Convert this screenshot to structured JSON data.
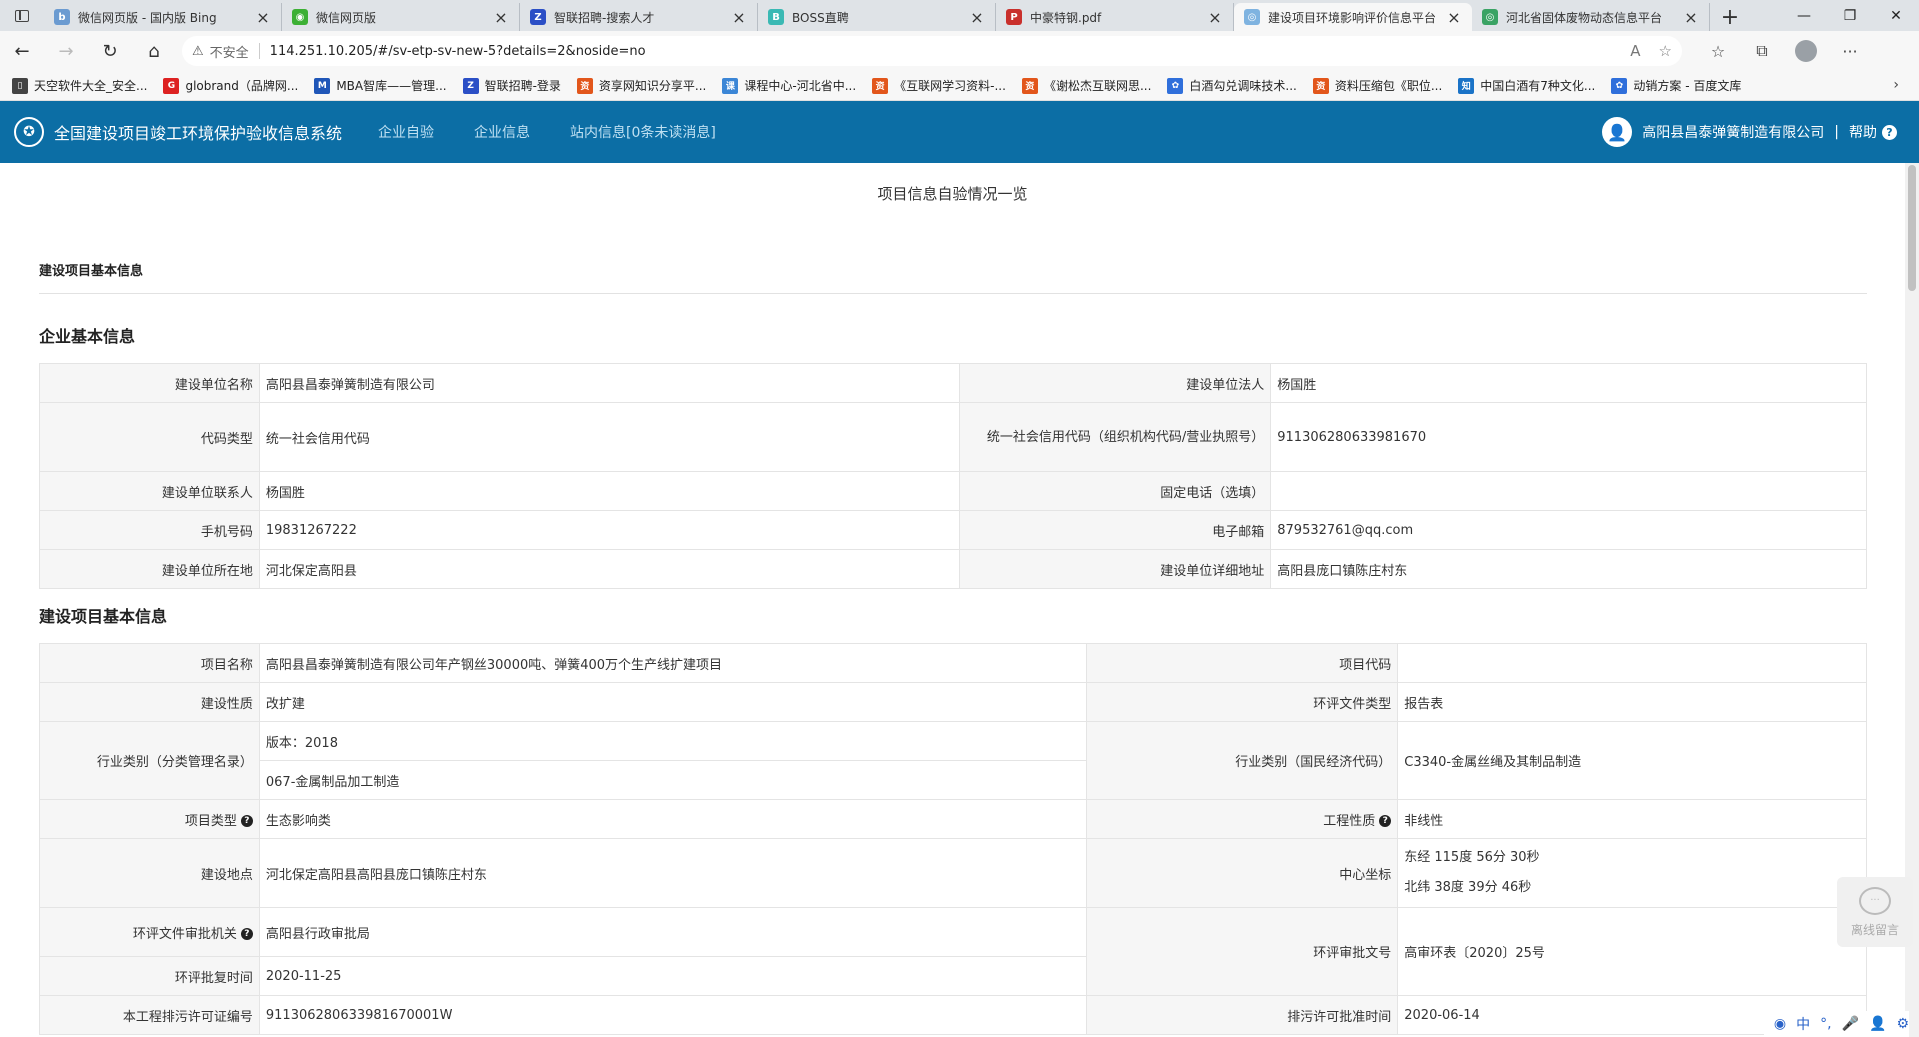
{
  "browser": {
    "tabs": [
      {
        "title": "微信网页版 - 国内版 Bing",
        "fav_color": "#6b9bd1",
        "fav_glyph": "b",
        "active": false
      },
      {
        "title": "微信网页版",
        "fav_color": "#3cb034",
        "fav_glyph": "◉",
        "active": false
      },
      {
        "title": "智联招聘-搜索人才",
        "fav_color": "#2b4fc6",
        "fav_glyph": "Z",
        "active": false
      },
      {
        "title": "BOSS直聘",
        "fav_color": "#3ab9b4",
        "fav_glyph": "B",
        "active": false
      },
      {
        "title": "中豪特钢.pdf",
        "fav_color": "#c9302c",
        "fav_glyph": "P",
        "active": false
      },
      {
        "title": "建设项目环境影响评价信息平台",
        "fav_color": "#7fb3e0",
        "fav_glyph": "◎",
        "active": true
      },
      {
        "title": "河北省固体废物动态信息平台",
        "fav_color": "#3aa364",
        "fav_glyph": "◎",
        "active": false
      }
    ],
    "address": {
      "security_label": "不安全",
      "url": "114.251.10.205/#/sv-etp-sv-new-5?details=2&noside=no"
    },
    "bookmarks": [
      {
        "label": "天空软件大全_安全...",
        "color": "#444",
        "glyph": "▯"
      },
      {
        "label": "globrand（品牌网...",
        "color": "#d22",
        "glyph": "G"
      },
      {
        "label": "MBA智库——管理...",
        "color": "#1f56b8",
        "glyph": "M"
      },
      {
        "label": "智联招聘-登录",
        "color": "#2b4fc6",
        "glyph": "Z"
      },
      {
        "label": "资享网知识分享平...",
        "color": "#e2561b",
        "glyph": "资"
      },
      {
        "label": "课程中心-河北省中...",
        "color": "#3b86d6",
        "glyph": "课"
      },
      {
        "label": "《互联网学习资料-...",
        "color": "#e2561b",
        "glyph": "资"
      },
      {
        "label": "《谢松杰互联网思...",
        "color": "#e2561b",
        "glyph": "资"
      },
      {
        "label": "白酒勾兑调味技术...",
        "color": "#2f6fdb",
        "glyph": "✿"
      },
      {
        "label": "资料压缩包《职位...",
        "color": "#e2561b",
        "glyph": "资"
      },
      {
        "label": "中国白酒有7种文化...",
        "color": "#1a73c7",
        "glyph": "知"
      },
      {
        "label": "动销方案 - 百度文库",
        "color": "#2f6fdb",
        "glyph": "✿"
      }
    ]
  },
  "app": {
    "system_title": "全国建设项目竣工环境保护验收信息系统",
    "nav": [
      "企业自验",
      "企业信息",
      "站内信息[0条未读消息]"
    ],
    "user_name": "高阳县昌泰弹簧制造有限公司",
    "help_label": "帮助",
    "separator": "|"
  },
  "page": {
    "heading": "项目信息自验情况一览",
    "section_title": "建设项目基本信息",
    "company_block_title": "企业基本信息",
    "project_block_title": "建设项目基本信息"
  },
  "company": {
    "unit_name_label": "建设单位名称",
    "unit_name": "高阳县昌泰弹簧制造有限公司",
    "legal_label": "建设单位法人",
    "legal": "杨国胜",
    "code_type_label": "代码类型",
    "code_type": "统一社会信用代码",
    "credit_code_label": "统一社会信用代码（组织机构代码/营业执照号）",
    "credit_code": "911306280633981670",
    "contact_label": "建设单位联系人",
    "contact": "杨国胜",
    "phone_label": "固定电话（选填）",
    "phone": "",
    "mobile_label": "手机号码",
    "mobile": "19831267222",
    "email_label": "电子邮箱",
    "email": "879532761@qq.com",
    "location_label": "建设单位所在地",
    "location": "河北保定高阳县",
    "address_label": "建设单位详细地址",
    "address": "高阳县庞口镇陈庄村东"
  },
  "project": {
    "name_label": "项目名称",
    "name": "高阳县昌泰弹簧制造有限公司年产钢丝30000吨、弹簧400万个生产线扩建项目",
    "code_label": "项目代码",
    "code": "",
    "nature_label": "建设性质",
    "nature": "改扩建",
    "eia_type_label": "环评文件类型",
    "eia_type": "报告表",
    "industry_cat_label": "行业类别（分类管理名录）",
    "industry_version": "版本：2018",
    "industry_cat": "067-金属制品加工制造",
    "industry_code_label": "行业类别（国民经济代码）",
    "industry_code": "C3340-金属丝绳及其制品制造",
    "proj_type_label": "项目类型",
    "proj_type": "生态影响类",
    "eng_nature_label": "工程性质",
    "eng_nature": "非线性",
    "site_label": "建设地点",
    "site": "河北保定高阳县高阳县庞口镇陈庄村东",
    "coord_label": "中心坐标",
    "lon": "东经 115度 56分 30秒",
    "lat": "北纬 38度 39分 46秒",
    "approver_label": "环评文件审批机关",
    "approver": "高阳县行政审批局",
    "approval_no_label": "环评审批文号",
    "approval_no": "高审环表〔2020〕25号",
    "approval_date_label": "环评批复时间",
    "approval_date": "2020-11-25",
    "permit_no_label": "本工程排污许可证编号",
    "permit_no": "911306280633981670001W",
    "permit_date_label": "排污许可批准时间",
    "permit_date": "2020-06-14"
  },
  "widgets": {
    "float_label": "离线留言",
    "ime_items": [
      "中",
      "°,",
      "🎤",
      "👤",
      "⚙"
    ]
  }
}
